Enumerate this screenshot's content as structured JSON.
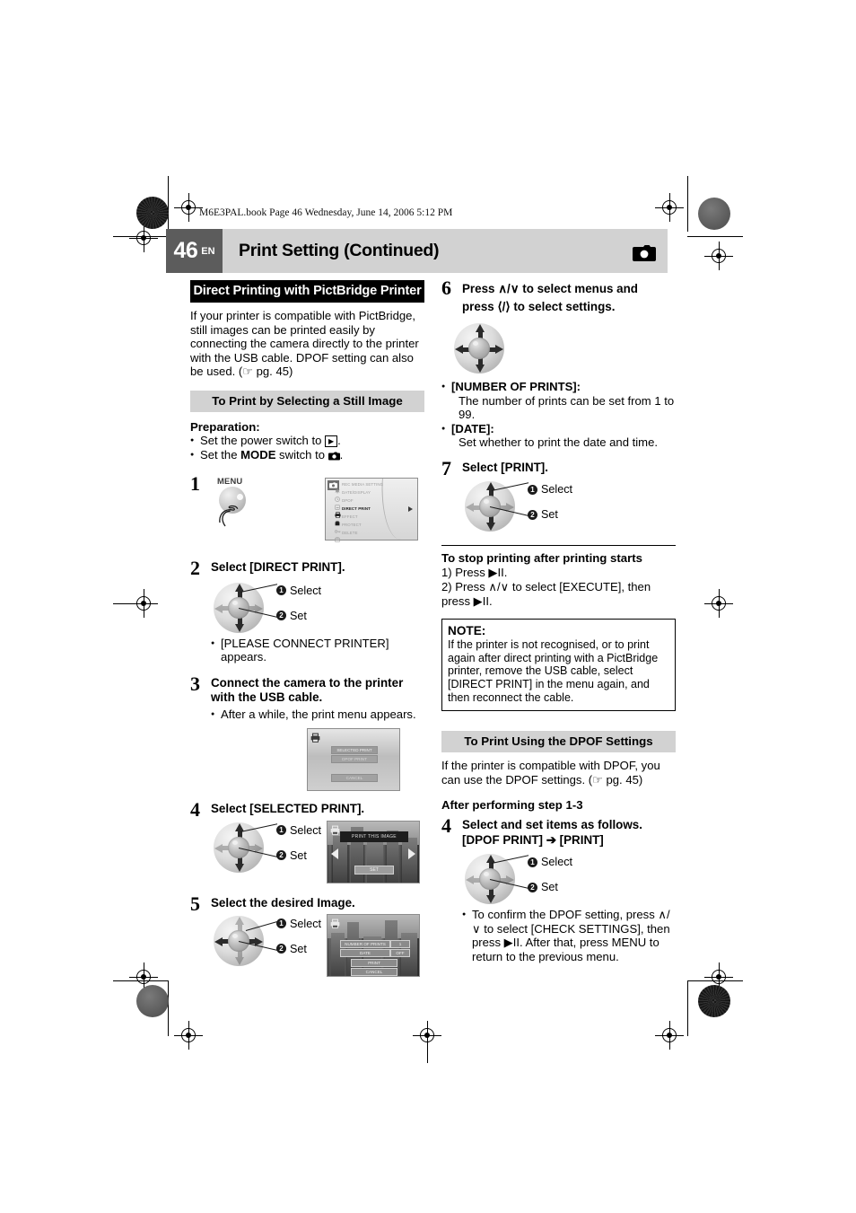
{
  "printer_marks": {
    "file_header": "M6E3PAL.book  Page 46  Wednesday, June 14, 2006  5:12 PM"
  },
  "header": {
    "page_number": "46",
    "language_code": "EN",
    "title": "Print Setting (Continued)",
    "mode_icon": "still-camera-icon"
  },
  "left_column": {
    "section_title": "Direct Printing with PictBridge Printer",
    "intro": "If your printer is compatible with PictBridge, still images can be printed easily by connecting the camera directly to the printer with the USB cable. DPOF setting can also be used. (☞ pg. 45)",
    "subsection_title": "To Print by Selecting a Still Image",
    "preparation_label": "Preparation:",
    "preparation_items": [
      "Set the power switch to ▶.",
      "Set the MODE switch to ●."
    ],
    "steps": [
      {
        "num": "1",
        "text": "",
        "button_label": "MENU",
        "lcd": {
          "type": "menu",
          "items": [
            {
              "label": "REC MEDIA SETTING",
              "selected": false
            },
            {
              "label": "DATE/DISPLAY",
              "selected": false
            },
            {
              "label": "DPOF",
              "selected": false
            },
            {
              "label": "DIRECT PRINT",
              "selected": true
            },
            {
              "label": "EFFECT",
              "selected": false
            },
            {
              "label": "PROTECT",
              "selected": false
            },
            {
              "label": "DELETE",
              "selected": false
            }
          ]
        }
      },
      {
        "num": "2",
        "text": "Select [DIRECT PRINT].",
        "callouts": [
          "Select",
          "Set"
        ],
        "note": "[PLEASE CONNECT PRINTER] appears."
      },
      {
        "num": "3",
        "text": "Connect the camera to the printer with the USB cable.",
        "note": "After a while, the print menu appears.",
        "lcd": {
          "type": "print-menu",
          "buttons": [
            {
              "label": "SELECTED PRINT",
              "selected": true
            },
            {
              "label": "DPOF PRINT",
              "selected": false
            },
            {
              "label": "CANCEL",
              "selected": false
            }
          ]
        }
      },
      {
        "num": "4",
        "text": "Select [SELECTED PRINT].",
        "callouts": [
          "Select",
          "Set"
        ],
        "lcd": {
          "type": "photo-select",
          "banner": "PRINT THIS IMAGE",
          "set_button": "SET"
        }
      },
      {
        "num": "5",
        "text": "Select the desired Image.",
        "callouts": [
          "Select",
          "Set"
        ],
        "lcd": {
          "type": "photo-options",
          "rows": [
            {
              "label": "NUMBER OF PRINTS",
              "value": "1"
            },
            {
              "label": "DATE",
              "value": "OFF"
            }
          ],
          "buttons": [
            "PRINT",
            "CANCEL"
          ]
        }
      }
    ]
  },
  "right_column": {
    "steps": [
      {
        "num": "6",
        "line1": "Press ∧/∨ to select menus and",
        "line2": "press ⟨/⟩ to select settings.",
        "bullets": [
          {
            "label": "[NUMBER OF PRINTS]:",
            "body": "The number of prints can be set from 1 to 99."
          },
          {
            "label": "[DATE]:",
            "body": "Set whether to print the date and time."
          }
        ]
      },
      {
        "num": "7",
        "text": "Select [PRINT].",
        "callouts": [
          "Select",
          "Set"
        ]
      }
    ],
    "stop_printing": {
      "heading": "To stop printing after printing starts",
      "items": [
        "1) Press ▶II.",
        "2) Press ∧/∨ to select [EXECUTE], then press ▶II."
      ]
    },
    "note": {
      "heading": "NOTE:",
      "body": "If the printer is not recognised, or to print again after direct printing with a PictBridge printer, remove the USB cable, select [DIRECT PRINT] in the menu again, and then reconnect the cable."
    },
    "dpof_section": {
      "title": "To Print Using the DPOF Settings",
      "intro": "If the printer is compatible with DPOF, you can use the DPOF settings. (☞ pg. 45)",
      "after_step": "After performing step 1-3",
      "step": {
        "num": "4",
        "line1": "Select and set items as follows.",
        "line2": "[DPOF PRINT] ➔ [PRINT]",
        "callouts": [
          "Select",
          "Set"
        ],
        "note": "To confirm the DPOF setting, press ∧/∨ to select [CHECK SETTINGS], then press ▶II. After that, press MENU to return to the previous menu."
      }
    }
  }
}
